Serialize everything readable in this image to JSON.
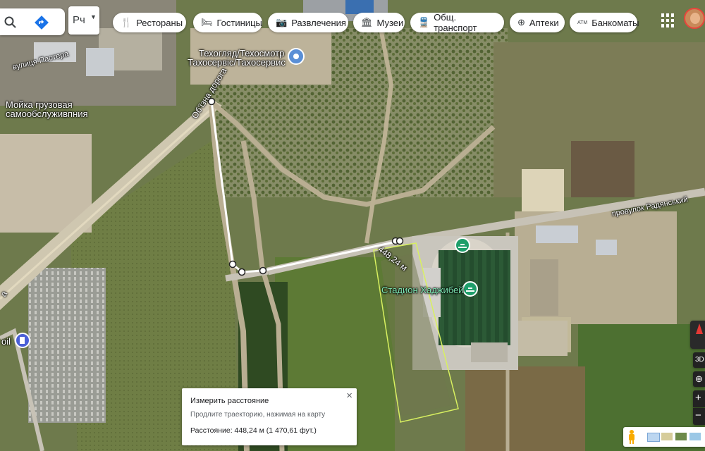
{
  "search": {
    "search_icon": "search-icon",
    "directions_icon": "directions-icon"
  },
  "layers_button": {
    "label": "Рч"
  },
  "chips": [
    {
      "label": "Рестораны",
      "icon": "restaurant-icon"
    },
    {
      "label": "Гостиницы",
      "icon": "hotel-icon"
    },
    {
      "label": "Развлечения",
      "icon": "camera-icon"
    },
    {
      "label": "Музеи",
      "icon": "museum-icon"
    },
    {
      "label": "Общ. транспорт",
      "icon": "transit-icon"
    },
    {
      "label": "Аптеки",
      "icon": "pharmacy-icon"
    },
    {
      "label": "Банкоматы",
      "icon": "atm-icon",
      "badge": "ATM"
    }
  ],
  "map_labels": {
    "street_pastera": "вулиця Пастера",
    "bypass_road": "Об'їзна дорога",
    "techinspection_line1": "Техогляд/Техосмотр",
    "techinspection_line2": "Тахосервіс/Тахосервис",
    "carwash_line1": "Мойка грузовая",
    "carwash_line2": "самообслуживпния",
    "radyansky_lane": "провулок Радянський",
    "stadium": "Стадион Хаджибей",
    "segment_distance": "448,24 м",
    "oil_fragment": "oil",
    "left_fragment": "а"
  },
  "measure_card": {
    "title": "Измерить расстояние",
    "hint": "Продлите траекторию, нажимая на карту",
    "distance": "Расстояние: 448,24 м (1 470,61 фут.)",
    "close_icon": "close-icon"
  },
  "right_controls": {
    "btn_3d": "3D",
    "zoom_in": "+",
    "zoom_out": "−"
  },
  "colors": {
    "route": "#ffffff",
    "pin": "#5a8fd6",
    "stadium_pin": "#1e9e6a",
    "fuel_pin": "#4a5fd6",
    "parcel_outline": "#d8f060"
  }
}
